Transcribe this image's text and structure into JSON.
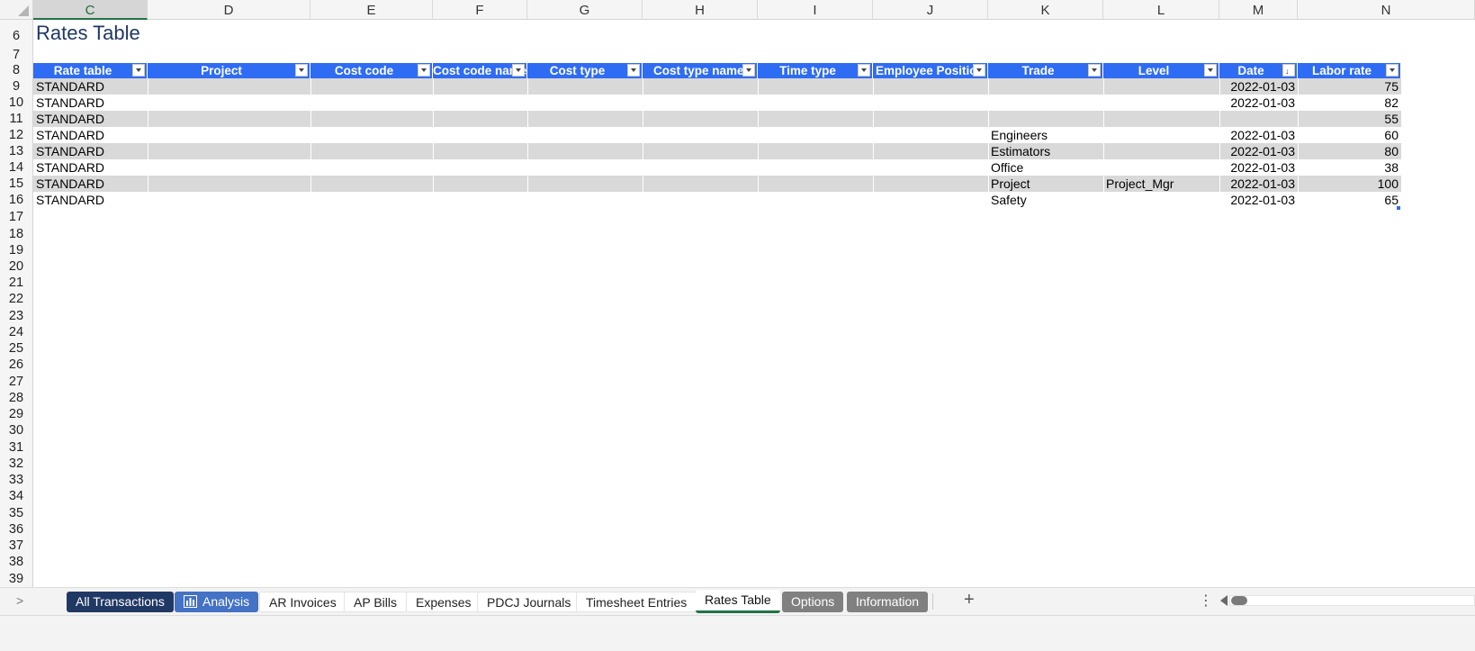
{
  "sheet": {
    "column_headers": [
      "C",
      "D",
      "E",
      "F",
      "G",
      "H",
      "I",
      "J",
      "K",
      "L",
      "M",
      "N"
    ],
    "selected_column": "C",
    "row_numbers": [
      "6",
      "7",
      "8",
      "9",
      "10",
      "11",
      "12",
      "13",
      "14",
      "15",
      "16",
      "17",
      "18",
      "19",
      "20",
      "21",
      "22",
      "23",
      "24",
      "25",
      "26",
      "27",
      "28",
      "29",
      "30",
      "31",
      "32",
      "33",
      "34",
      "35",
      "36",
      "37",
      "38",
      "39"
    ],
    "title": "Rates Table"
  },
  "table": {
    "headers": [
      "Rate table",
      "Project",
      "Cost code",
      "Cost code name",
      "Cost type",
      "Cost type name",
      "Time type",
      "Employee Position",
      "Trade",
      "Level",
      "Date",
      "Labor rate"
    ],
    "rows": [
      {
        "rate_table": "STANDARD",
        "trade": "",
        "level": "",
        "date": "2022-01-03",
        "labor_rate": "75"
      },
      {
        "rate_table": "STANDARD",
        "trade": "",
        "level": "",
        "date": "2022-01-03",
        "labor_rate": "82"
      },
      {
        "rate_table": "STANDARD",
        "trade": "",
        "level": "",
        "date": "",
        "labor_rate": "55"
      },
      {
        "rate_table": "STANDARD",
        "trade": "Engineers",
        "level": "",
        "date": "2022-01-03",
        "labor_rate": "60"
      },
      {
        "rate_table": "STANDARD",
        "trade": "Estimators",
        "level": "",
        "date": "2022-01-03",
        "labor_rate": "80"
      },
      {
        "rate_table": "STANDARD",
        "trade": "Office",
        "level": "",
        "date": "2022-01-03",
        "labor_rate": "38"
      },
      {
        "rate_table": "STANDARD",
        "trade": "Project",
        "level": "Project_Mgr",
        "date": "2022-01-03",
        "labor_rate": "100"
      },
      {
        "rate_table": "STANDARD",
        "trade": "Safety",
        "level": "",
        "date": "2022-01-03",
        "labor_rate": "65"
      }
    ]
  },
  "sheet_tabs": {
    "items": [
      {
        "label": "All Transactions",
        "style": "dark"
      },
      {
        "label": "Analysis",
        "style": "blue",
        "icon": "bar-chart-icon"
      },
      {
        "label": "AR Invoices",
        "style": "light"
      },
      {
        "label": "AP Bills",
        "style": "light"
      },
      {
        "label": "Expenses",
        "style": "light"
      },
      {
        "label": "PDCJ Journals",
        "style": "light"
      },
      {
        "label": "Timesheet Entries",
        "style": "light"
      },
      {
        "label": "Rates Table",
        "style": "active"
      },
      {
        "label": "Options",
        "style": "grey"
      },
      {
        "label": "Information",
        "style": "grey"
      }
    ],
    "active": "Rates Table"
  },
  "colors": {
    "table_header": "#2f6cf4",
    "band": "#d9d9d9",
    "title": "#1f3864",
    "tab_dark": "#203864",
    "tab_blue": "#4472c4",
    "tab_grey": "#808080",
    "active_underline": "#217346"
  }
}
